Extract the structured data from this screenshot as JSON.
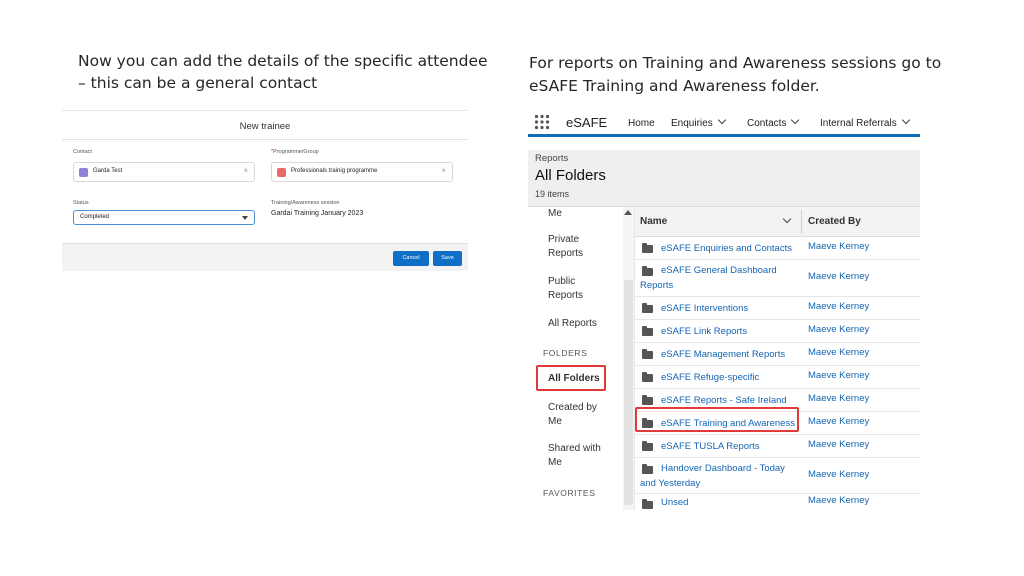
{
  "left_caption": {
    "line1": "Now you can add the details of the specific attendee",
    "line2": "– this can be a general contact"
  },
  "right_caption": {
    "line1": "For reports on Training and Awareness sessions go to",
    "line2": "eSAFE Training and Awareness folder."
  },
  "modal": {
    "title": "New trainee",
    "contact_label": "Contact",
    "contact_value": "Garda Test",
    "programme_required": "*",
    "programme_label": "Programme/Group",
    "programme_value": "Professionals trainig programme",
    "status_label": "Status",
    "status_value": "Completed",
    "session_label": "Training/Awareness session",
    "session_value": "Gardai Training January 2023",
    "cancel_label": "Cancel",
    "save_label": "Save",
    "clear_glyph": "×"
  },
  "sf": {
    "app_name": "eSAFE",
    "nav": [
      "Home",
      "Enquiries",
      "Contacts",
      "Internal Referrals"
    ],
    "breadcrumb": "Reports",
    "page_title": "All Folders",
    "item_count": "19 items",
    "sidebar": {
      "me": "Me",
      "private_1": "Private",
      "private_2": "Reports",
      "public_1": "Public",
      "public_2": "Reports",
      "all_reports": "All Reports",
      "folders_heading": "FOLDERS",
      "all_folders": "All Folders",
      "created_1": "Created by",
      "created_2": "Me",
      "shared_1": "Shared with",
      "shared_2": "Me",
      "favorites_heading": "FAVORITES"
    },
    "columns": {
      "name": "Name",
      "created_by": "Created By"
    },
    "rows": [
      {
        "name": "eSAFE Enquiries and Contacts",
        "by": "Maeve Kerney"
      },
      {
        "name": "eSAFE General Dashboard",
        "name2": "Reports",
        "by": "Maeve Kerney"
      },
      {
        "name": "eSAFE Interventions",
        "by": "Maeve Kerney"
      },
      {
        "name": "eSAFE Link Reports",
        "by": "Maeve Kerney"
      },
      {
        "name": "eSAFE Management Reports",
        "by": "Maeve Kerney"
      },
      {
        "name": "eSAFE Refuge-specific",
        "by": "Maeve Kerney"
      },
      {
        "name": "eSAFE Reports - Safe Ireland",
        "by": "Maeve Kerney"
      },
      {
        "name": "eSAFE Training and Awareness",
        "by": "Maeve Kerney"
      },
      {
        "name": "eSAFE TUSLA Reports",
        "by": "Maeve Kerney"
      },
      {
        "name": "Handover Dashboard - Today",
        "name2": "and Yesterday",
        "by": "Maeve Kerney"
      },
      {
        "name": "Unsed",
        "by": "Maeve Kerney"
      }
    ]
  },
  "colors": {
    "brand_blue": "#0d6fb8",
    "link": "#1565b3",
    "highlight": "#e03a3a"
  }
}
